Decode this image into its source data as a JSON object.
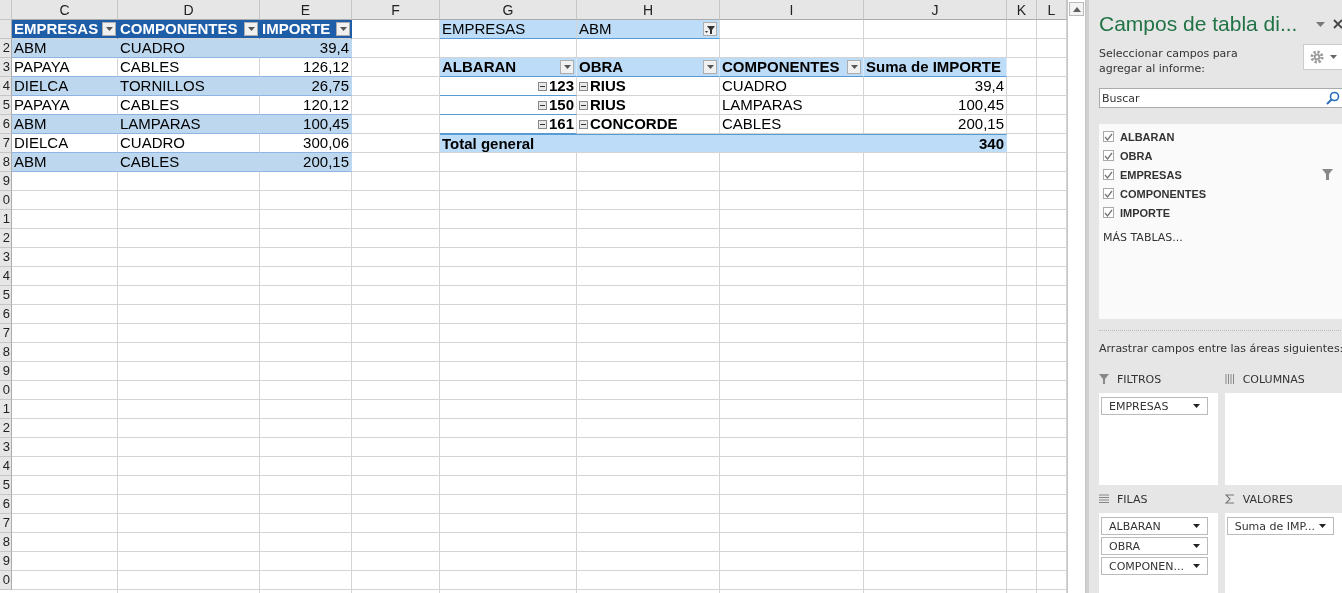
{
  "sheet": {
    "column_headers": [
      "C",
      "D",
      "E",
      "F",
      "G",
      "H",
      "I",
      "J",
      "K",
      "L"
    ],
    "row_numbers": [
      "2",
      "3",
      "4",
      "5",
      "6",
      "7",
      "8",
      "9",
      "0",
      "1",
      "2",
      "3",
      "4",
      "5",
      "6",
      "7",
      "8",
      "9",
      "0",
      "1",
      "2",
      "3",
      "4",
      "5",
      "6",
      "7",
      "8",
      "9",
      "0"
    ]
  },
  "table": {
    "columns": [
      "EMPRESAS",
      "COMPONENTES",
      "IMPORTE"
    ],
    "rows": [
      [
        "ABM",
        "CUADRO",
        "39,4"
      ],
      [
        "PAPAYA",
        "CABLES",
        "126,12"
      ],
      [
        "DIELCA",
        "TORNILLOS",
        "26,75"
      ],
      [
        "PAPAYA",
        "CABLES",
        "120,12"
      ],
      [
        "ABM",
        "LAMPARAS",
        "100,45"
      ],
      [
        "DIELCA",
        "CUADRO",
        "300,06"
      ],
      [
        "ABM",
        "CABLES",
        "200,15"
      ]
    ]
  },
  "pivot": {
    "filter": {
      "field": "EMPRESAS",
      "value": "ABM"
    },
    "columns": [
      "ALBARAN",
      "OBRA",
      "COMPONENTES",
      "Suma de IMPORTE"
    ],
    "rows": [
      {
        "albaran": "123",
        "albaran_expanded": true,
        "obra": "RIUS",
        "obra_expanded": true,
        "componentes": "CUADRO",
        "importe": "39,4"
      },
      {
        "albaran": "150",
        "albaran_expanded": true,
        "obra": "RIUS",
        "obra_expanded": true,
        "componentes": "LAMPARAS",
        "importe": "100,45"
      },
      {
        "albaran": "161",
        "albaran_expanded": true,
        "obra": "CONCORDE",
        "obra_expanded": true,
        "componentes": "CABLES",
        "importe": "200,15"
      }
    ],
    "total": {
      "label": "Total general",
      "value": "340"
    }
  },
  "panel": {
    "title": "Campos de tabla di...",
    "subtitle": "Seleccionar campos para agregar al informe:",
    "search": {
      "placeholder": "Buscar"
    },
    "fields": [
      {
        "label": "ALBARAN",
        "checked": true,
        "filtered": false
      },
      {
        "label": "OBRA",
        "checked": true,
        "filtered": false
      },
      {
        "label": "EMPRESAS",
        "checked": true,
        "filtered": true
      },
      {
        "label": "COMPONENTES",
        "checked": true,
        "filtered": false
      },
      {
        "label": "IMPORTE",
        "checked": true,
        "filtered": false
      }
    ],
    "more_tables": "MÁS TABLAS...",
    "areas_hint": "Arrastrar campos entre las áreas siguientes:",
    "areas": [
      {
        "kind": "filters",
        "title": "FILTROS",
        "items": [
          "EMPRESAS"
        ]
      },
      {
        "kind": "columns",
        "title": "COLUMNAS"
      },
      {
        "kind": "rows",
        "title": "FILAS",
        "items": [
          "ALBARAN",
          "OBRA",
          "COMPONEN..."
        ]
      },
      {
        "kind": "values",
        "title": "VALORES",
        "items": [
          "Suma de IMP..."
        ]
      }
    ]
  }
}
